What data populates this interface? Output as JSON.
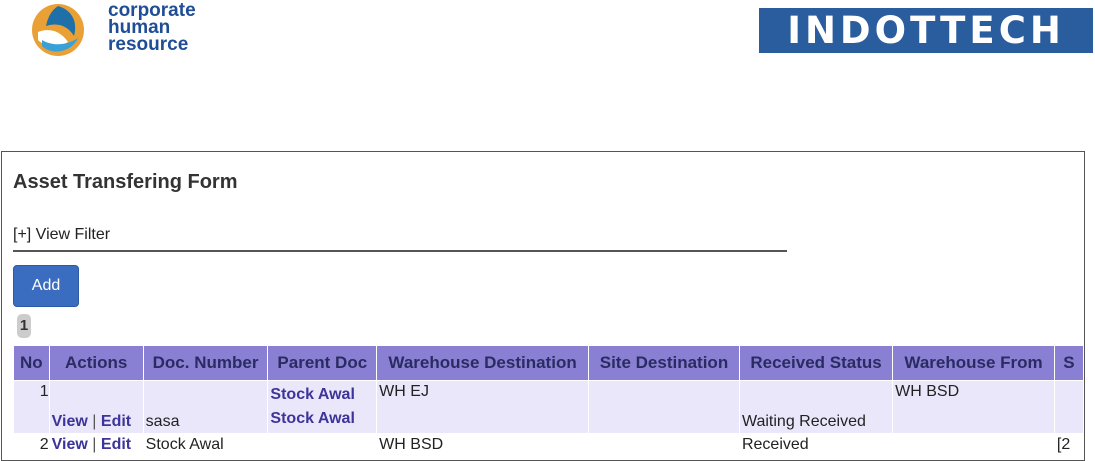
{
  "brand": {
    "left_name_lines": [
      "corporate",
      "human",
      "resource"
    ],
    "right_logo_text": "INDOTTECH"
  },
  "page": {
    "title": "Asset Transfering Form",
    "filter_toggle": "[+]",
    "filter_label": " View Filter",
    "add_label": "Add",
    "current_page": "1"
  },
  "table": {
    "columns": [
      "No",
      "Actions",
      "Doc. Number",
      "Parent Doc",
      "Warehouse Destination",
      "Site Destination",
      "Received Status",
      "Warehouse From",
      "S"
    ],
    "action_view": "View",
    "action_separator": "|",
    "action_edit": "Edit",
    "rows": [
      {
        "no": "1",
        "doc_number": "sasa",
        "parent_doc": [
          "Stock Awal",
          "Stock Awal"
        ],
        "warehouse_destination": "WH EJ",
        "site_destination": "",
        "received_status": "Waiting Received",
        "warehouse_from": "WH BSD",
        "extra": ""
      },
      {
        "no": "2",
        "doc_number": "Stock Awal",
        "parent_doc": [],
        "warehouse_destination": "WH BSD",
        "site_destination": "",
        "received_status": "Received",
        "warehouse_from": "",
        "extra": "[2"
      }
    ]
  },
  "colors": {
    "header_bg": "#8a80d3",
    "row_alt_bg": "#ebe7fb",
    "link": "#3d3499",
    "add_button": "#3a6cbf",
    "brand_blue": "#2a5d9e"
  }
}
